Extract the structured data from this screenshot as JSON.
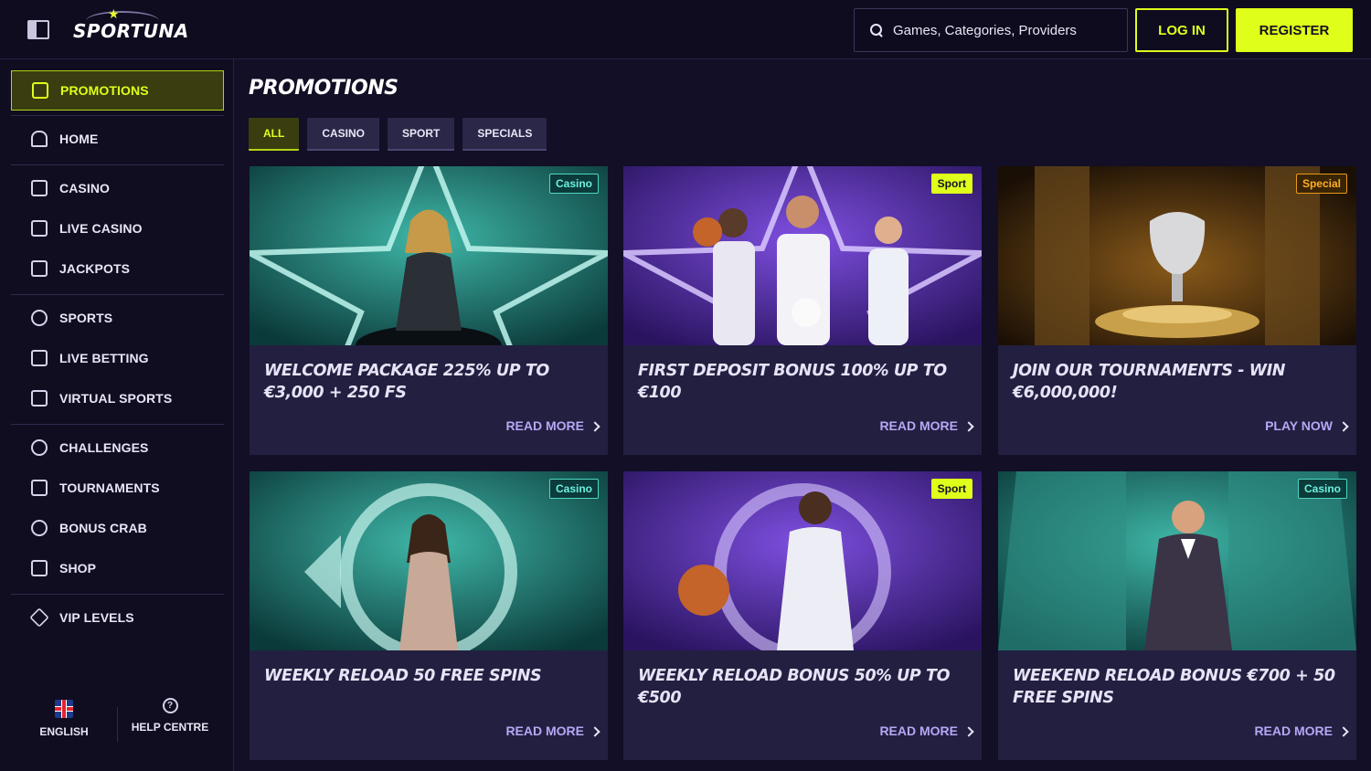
{
  "header": {
    "logo_text": "SPORTUNA",
    "search_placeholder": "Games, Categories, Providers",
    "login_label": "LOG IN",
    "register_label": "REGISTER"
  },
  "sidebar": {
    "items": [
      {
        "label": "PROMOTIONS",
        "icon": "gift-icon",
        "active": true
      },
      {
        "label": "HOME",
        "icon": "home-icon"
      },
      {
        "label": "CASINO",
        "icon": "casino-icon"
      },
      {
        "label": "LIVE CASINO",
        "icon": "live-casino-icon"
      },
      {
        "label": "JACKPOTS",
        "icon": "jackpots-icon"
      },
      {
        "label": "SPORTS",
        "icon": "soccer-ball-icon"
      },
      {
        "label": "LIVE BETTING",
        "icon": "video-camera-icon"
      },
      {
        "label": "VIRTUAL SPORTS",
        "icon": "gamepad-icon"
      },
      {
        "label": "CHALLENGES",
        "icon": "medal-icon"
      },
      {
        "label": "TOURNAMENTS",
        "icon": "trophy-icon"
      },
      {
        "label": "BONUS CRAB",
        "icon": "crab-icon"
      },
      {
        "label": "SHOP",
        "icon": "shop-basket-icon"
      },
      {
        "label": "VIP LEVELS",
        "icon": "diamond-icon"
      }
    ],
    "footer": {
      "language_label": "ENGLISH",
      "help_label": "HELP CENTRE"
    }
  },
  "main": {
    "title": "PROMOTIONS",
    "filters": [
      {
        "label": "ALL",
        "active": true
      },
      {
        "label": "CASINO"
      },
      {
        "label": "SPORT"
      },
      {
        "label": "SPECIALS"
      }
    ],
    "cards": [
      {
        "tag": "Casino",
        "title": "WELCOME PACKAGE 225% UP TO €3,000 + 250 FS",
        "cta": "READ MORE"
      },
      {
        "tag": "Sport",
        "title": "FIRST DEPOSIT BONUS 100% UP TO €100",
        "cta": "READ MORE"
      },
      {
        "tag": "Special",
        "title": "JOIN OUR TOURNAMENTS - WIN €6,000,000!",
        "cta": "PLAY NOW"
      },
      {
        "tag": "Casino",
        "title": "WEEKLY RELOAD 50 FREE SPINS",
        "cta": "READ MORE"
      },
      {
        "tag": "Sport",
        "title": "WEEKLY RELOAD BONUS 50% UP TO €500",
        "cta": "READ MORE"
      },
      {
        "tag": "Casino",
        "title": "WEEKEND RELOAD BONUS €700 + 50 FREE SPINS",
        "cta": "READ MORE"
      }
    ]
  },
  "colors": {
    "accent": "#dfff1a",
    "background": "#120f26",
    "card": "#231f40",
    "casino_tag": "#4fd6c4",
    "special_tag": "#e89a16",
    "cta_text": "#b5a8f5"
  }
}
